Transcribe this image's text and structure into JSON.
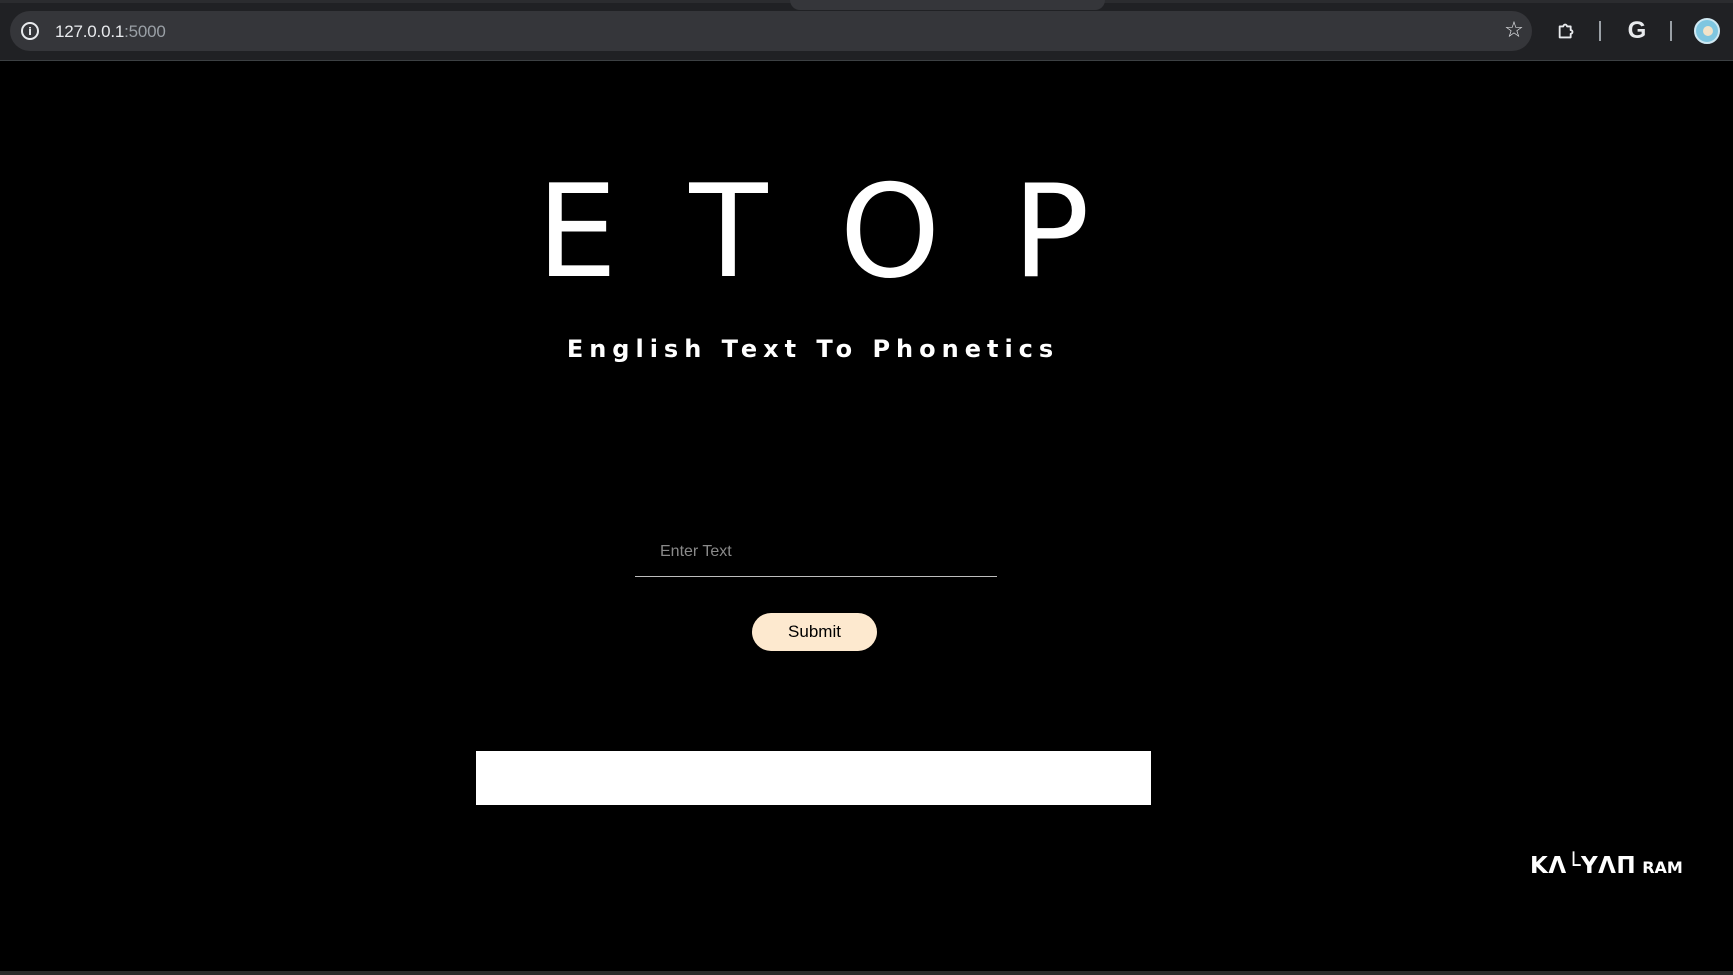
{
  "browser": {
    "url_host": "127.0.0.1",
    "url_port": ":5000",
    "icons": [
      "info-icon",
      "star-icon",
      "extensions-icon",
      "google-icon",
      "avatar"
    ]
  },
  "page": {
    "title": "ETOP",
    "subtitle": "English Text To Phonetics",
    "input_placeholder": "Enter Text",
    "input_value": "",
    "submit_label": "Submit",
    "output_text": "",
    "signature_main": "KΛ└YΛП",
    "signature_small": "RAM"
  },
  "colors": {
    "background": "#000000",
    "submit_button": "#fde9cf",
    "output_box": "#ffffff",
    "text": "#ffffff"
  }
}
